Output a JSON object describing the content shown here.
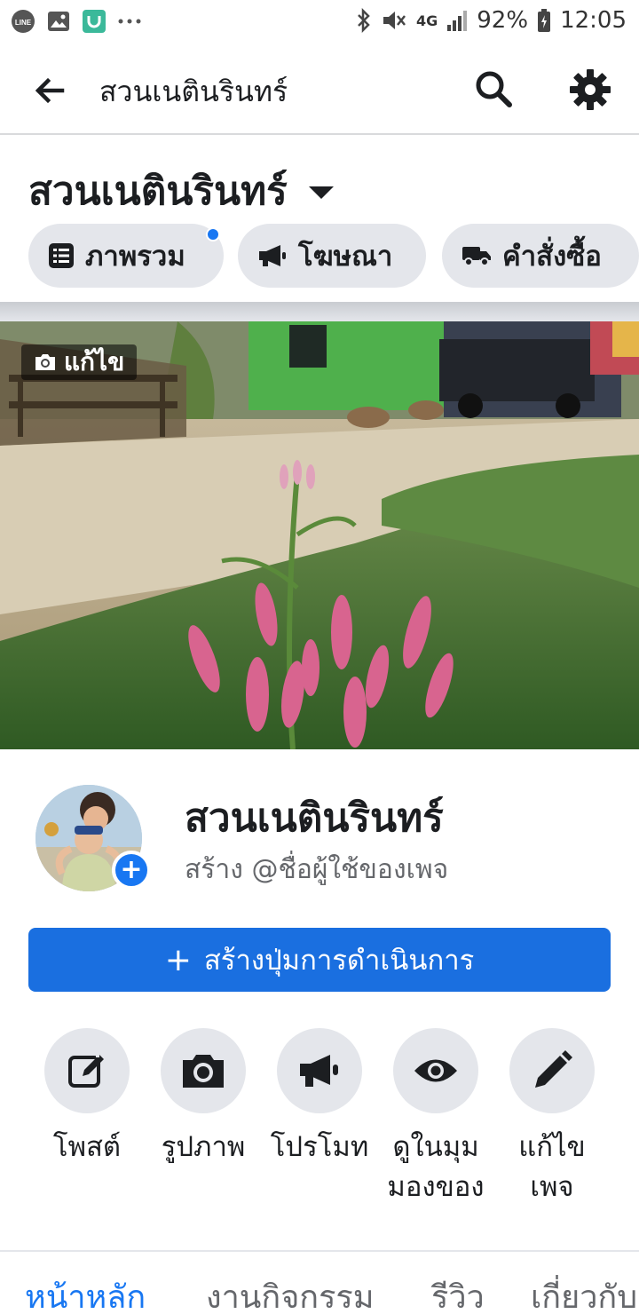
{
  "status_bar": {
    "time": "12:05",
    "battery": "92%",
    "network": "4G",
    "left_icons": [
      "line-icon",
      "gallery-icon",
      "mi-icon",
      "more-dots-icon"
    ],
    "right_icons": [
      "bluetooth-icon",
      "mute-icon",
      "signal-icon",
      "battery-icon"
    ]
  },
  "app_bar": {
    "title": "สวนเนตินรินทร์",
    "icons": [
      "back-arrow-icon",
      "search-icon",
      "settings-gear-icon"
    ]
  },
  "header": {
    "page_name": "สวนเนตินรินทร์",
    "chips": [
      {
        "label": "ภาพรวม",
        "icon": "list-icon",
        "has_notification": true
      },
      {
        "label": "โฆษณา",
        "icon": "megaphone-icon",
        "has_notification": false
      },
      {
        "label": "คำสั่งซื้อ",
        "icon": "truck-icon",
        "has_notification": false
      }
    ]
  },
  "cover": {
    "edit_label": "แก้ไข"
  },
  "profile": {
    "name": "สวนเนตินรินทร์",
    "username_prompt": "สร้าง @ชื่อผู้ใช้ของเพจ"
  },
  "cta": {
    "label": "สร้างปุ่มการดำเนินการ",
    "plus": "+"
  },
  "actions": [
    {
      "label": "โพสต์",
      "icon": "edit-post-icon"
    },
    {
      "label": "รูปภาพ",
      "icon": "camera-icon"
    },
    {
      "label": "โปรโมท",
      "icon": "megaphone-icon"
    },
    {
      "label": "ดูในมุม\nมองของ",
      "icon": "eye-icon"
    },
    {
      "label": "แก้ไข\nเพจ",
      "icon": "pencil-icon"
    }
  ],
  "tabs": [
    {
      "label": "หน้าหลัก",
      "active": true
    },
    {
      "label": "งานกิจกรรม",
      "active": false
    },
    {
      "label": "รีวิว",
      "active": false
    },
    {
      "label": "เกี่ยวกับ",
      "active": false
    }
  ],
  "colors": {
    "accent": "#1877f2",
    "cta_bg": "#1a6fe0",
    "chip_bg": "#e4e6eb",
    "text_primary": "#1c1e21",
    "text_secondary": "#65676b"
  }
}
